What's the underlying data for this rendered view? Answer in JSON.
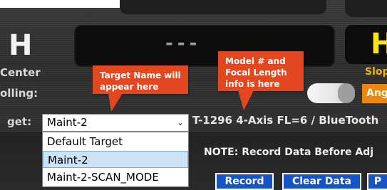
{
  "display": {
    "left_value": "H",
    "center_value": "---",
    "right_value": "H"
  },
  "labels": {
    "center": "Center",
    "rolling": "olling:",
    "target": "get:",
    "slope": "Slop",
    "angle_button": "Ang"
  },
  "callouts": {
    "target_name": "Target Name will appear here",
    "model_info": "Model # and Focal Length info is here"
  },
  "target_select": {
    "selected": "Maint-2",
    "options": [
      "Default Target",
      "Maint-2",
      "Maint-2-SCAN_MODE"
    ],
    "highlighted_index": 1
  },
  "device_info": "T-1296 4-Axis FL=6 / BlueTooth",
  "note": "NOTE: Record Data Before Adj",
  "buttons": {
    "record": "Record",
    "clear_data": "Clear Data",
    "partial": "P"
  },
  "colors": {
    "callout": "#e2471f",
    "button_blue": "#1553c9",
    "accent_yellow": "#f6e31b",
    "accent_orange": "#e8860f",
    "selected_option": "#cde3f5"
  }
}
